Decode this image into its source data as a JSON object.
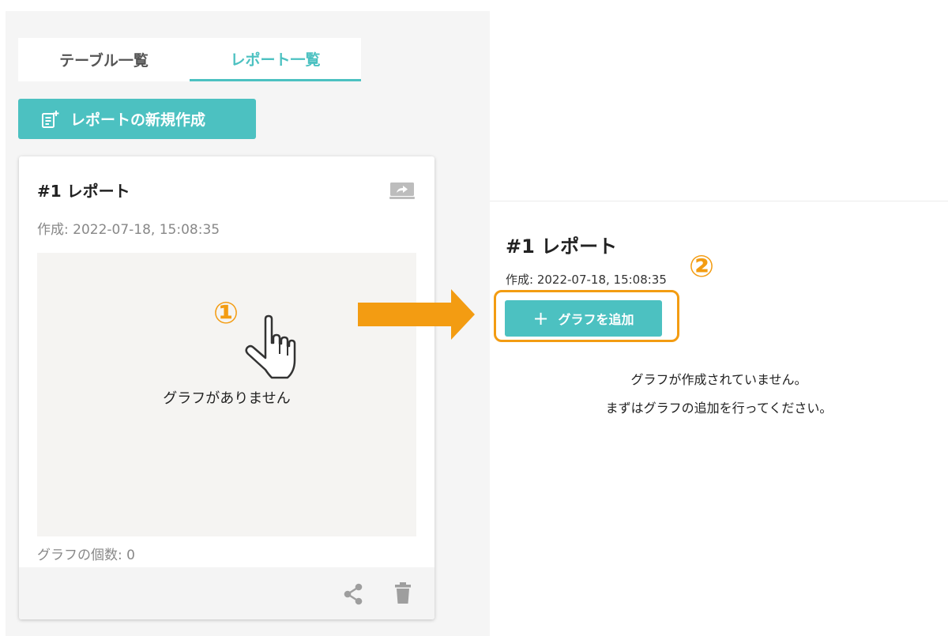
{
  "tabs": [
    {
      "label": "テーブル一覧",
      "active": false
    },
    {
      "label": "レポート一覧",
      "active": true
    }
  ],
  "new_report_button": {
    "label": "レポートの新規作成",
    "icon": "note-add-icon"
  },
  "report_card": {
    "title": "#1 レポート",
    "created": "作成: 2022-07-18, 15:08:35",
    "empty_text": "グラフがありません",
    "graph_count": "グラフの個数: 0",
    "icons": [
      "present-icon",
      "share-icon",
      "trash-icon"
    ]
  },
  "annotations": {
    "step1": "①",
    "step2": "②"
  },
  "report_detail": {
    "title": "#1 レポート",
    "created": "作成: 2022-07-18, 15:08:35",
    "add_graph_label": "グラフを追加",
    "empty_message_1": "グラフが作成されていません。",
    "empty_message_2": "まずはグラフの追加を行ってください。"
  },
  "colors": {
    "accent": "#4cc1c1",
    "annotation": "#f39c12",
    "panel_bg": "#f5f5f5"
  }
}
